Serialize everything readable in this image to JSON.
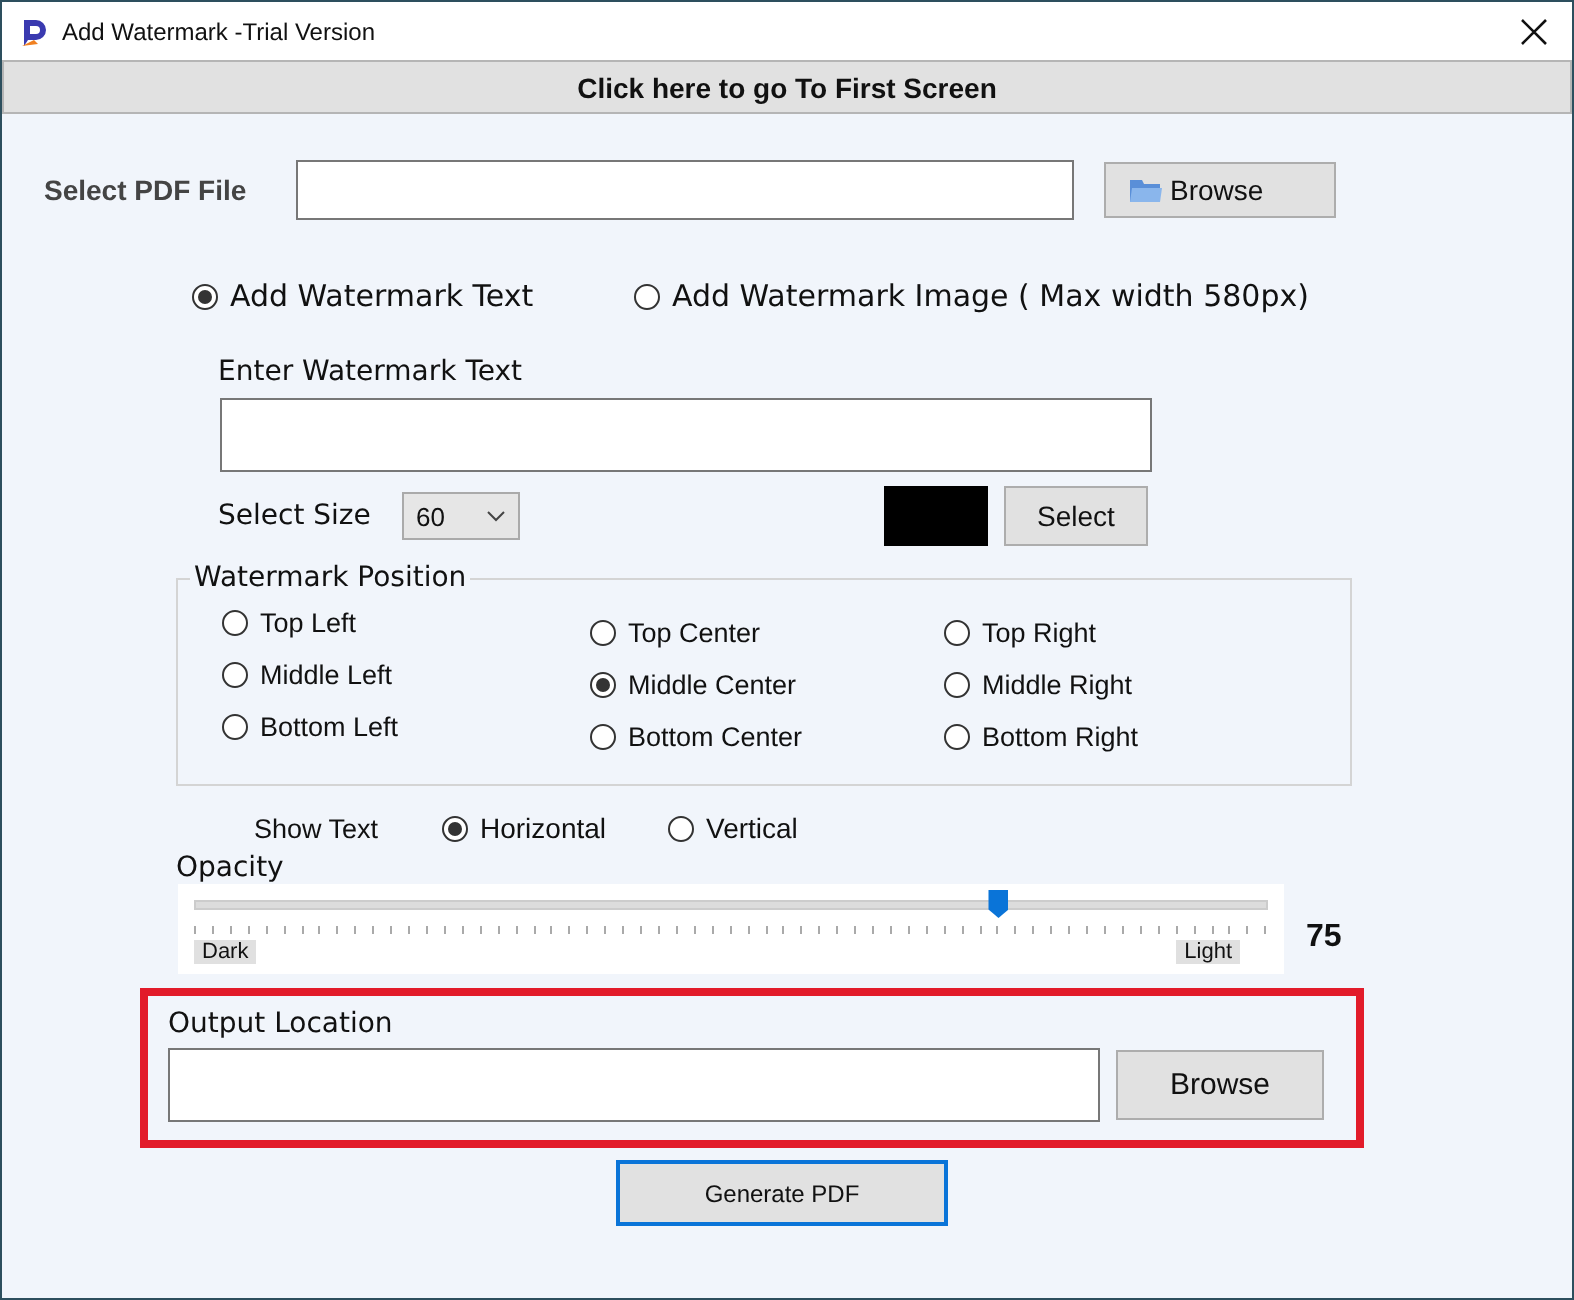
{
  "window": {
    "title": "Add Watermark  -Trial Version"
  },
  "first_screen_button": "Click here to go To First Screen",
  "pdf_file": {
    "label": "Select PDF File",
    "browse": "Browse"
  },
  "mode_options": [
    {
      "label": "Add Watermark Text",
      "selected": true
    },
    {
      "label": "Add Watermark Image ( Max width 580px)",
      "selected": false
    }
  ],
  "watermark_text": {
    "label": "Enter Watermark Text"
  },
  "size": {
    "label": "Select Size",
    "value": "60"
  },
  "color": {
    "color": "#000000",
    "button": "Select"
  },
  "position": {
    "legend": "Watermark Position",
    "options": [
      {
        "label": "Top Left",
        "selected": false
      },
      {
        "label": "Top Center",
        "selected": false
      },
      {
        "label": "Top Right",
        "selected": false
      },
      {
        "label": "Middle Left",
        "selected": false
      },
      {
        "label": "Middle Center",
        "selected": true
      },
      {
        "label": "Middle Right",
        "selected": false
      },
      {
        "label": "Bottom Left",
        "selected": false
      },
      {
        "label": "Bottom Center",
        "selected": false
      },
      {
        "label": "Bottom Right",
        "selected": false
      }
    ]
  },
  "show_text": {
    "label": "Show Text",
    "options": [
      {
        "label": "Horizontal",
        "selected": true
      },
      {
        "label": "Vertical",
        "selected": false
      }
    ]
  },
  "opacity": {
    "label": "Opacity",
    "level": 0.75,
    "min_label": "Dark",
    "max_label": "Light",
    "value": "75"
  },
  "output": {
    "label": "Output Location",
    "browse": "Browse",
    "highlighted": true
  },
  "generate_button": "Generate PDF"
}
